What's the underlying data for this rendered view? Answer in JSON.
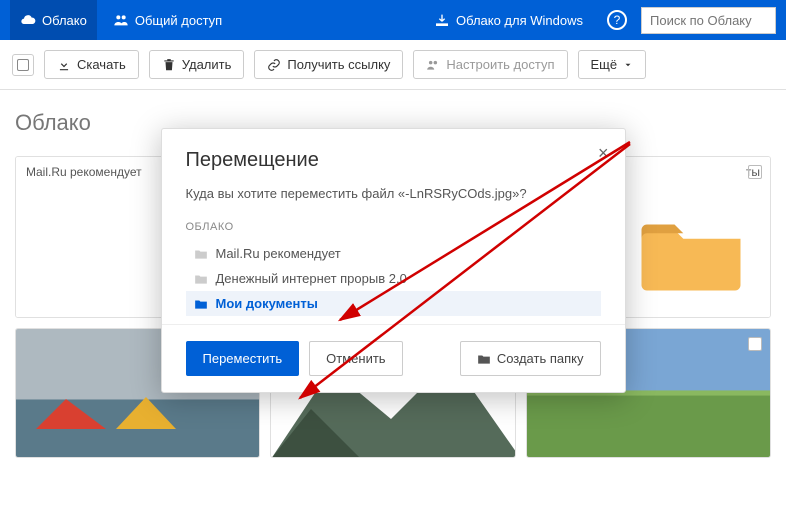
{
  "nav": {
    "cloud": "Облако",
    "shared": "Общий доступ",
    "windows": "Облако для Windows"
  },
  "search": {
    "placeholder": "Поиск по Облаку"
  },
  "toolbar": {
    "download": "Скачать",
    "delete": "Удалить",
    "link": "Получить ссылку",
    "access": "Настроить доступ",
    "more": "Ещё"
  },
  "section": {
    "title": "Облако"
  },
  "folders": {
    "a": "Mail.Ru рекомендует",
    "b": "ты"
  },
  "modal": {
    "title": "Перемещение",
    "subtitle": "Куда вы хотите переместить файл «-LnRSRyCOds.jpg»?",
    "tree_head": "ОБЛАКО",
    "items": [
      {
        "label": "Mail.Ru рекомендует"
      },
      {
        "label": "Денежный интернет прорыв 2.0"
      },
      {
        "label": "Мои документы"
      }
    ],
    "move": "Переместить",
    "cancel": "Отменить",
    "create": "Создать папку"
  }
}
